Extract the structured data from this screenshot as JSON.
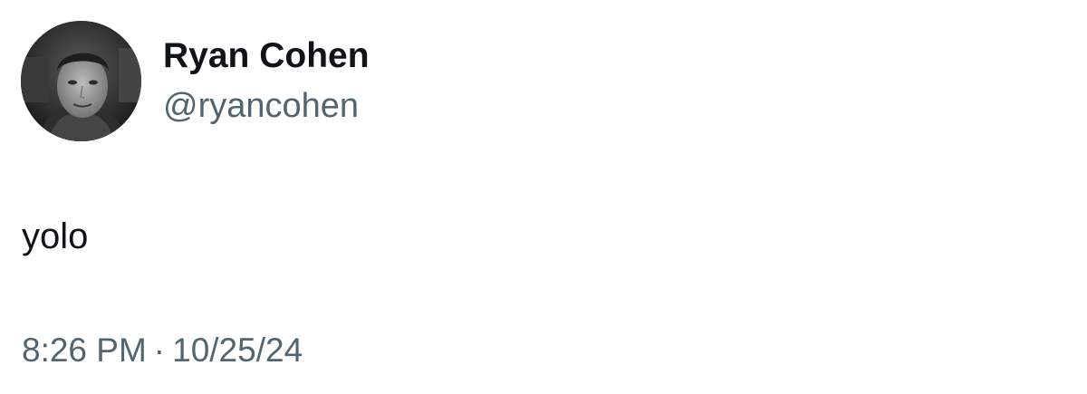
{
  "author": {
    "display_name": "Ryan Cohen",
    "handle": "@ryancohen",
    "avatar_icon": "profile-photo"
  },
  "tweet": {
    "text": "yolo",
    "time": "8:26 PM",
    "separator": "·",
    "date": "10/25/24"
  },
  "colors": {
    "name": "#0f1419",
    "secondary": "#536471",
    "background": "#ffffff"
  }
}
